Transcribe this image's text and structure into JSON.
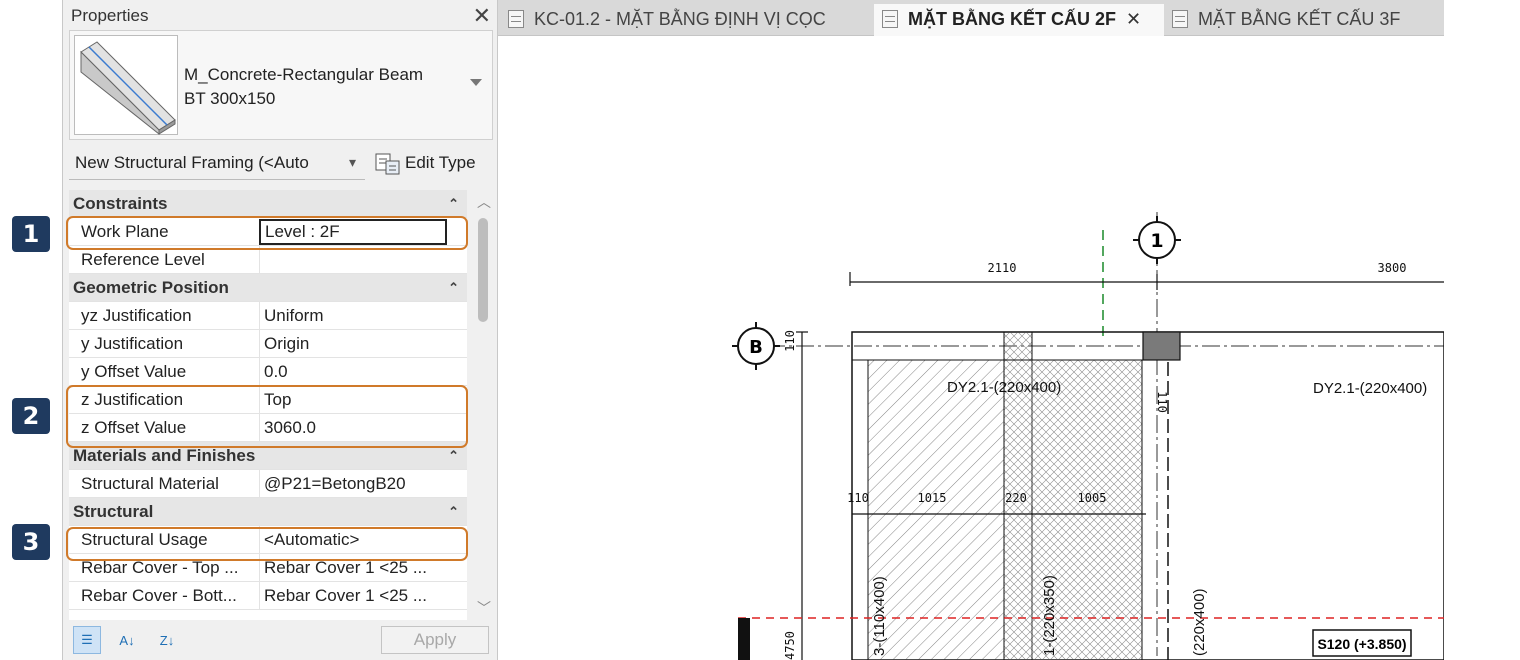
{
  "badges": [
    "1",
    "2",
    "3"
  ],
  "properties": {
    "title": "Properties",
    "family_line1": "M_Concrete-Rectangular Beam",
    "family_line2": "BT 300x150",
    "instance_selector": "New Structural Framing (<Auto",
    "edit_type_label": "Edit Type",
    "sections": {
      "constraints": "Constraints",
      "geometric_position": "Geometric Position",
      "materials": "Materials and Finishes",
      "structural": "Structural"
    },
    "rows": [
      {
        "name": "Work Plane",
        "value": "Level : 2F"
      },
      {
        "name": "Reference Level",
        "value": ""
      },
      {
        "name": "yz Justification",
        "value": "Uniform"
      },
      {
        "name": "y Justification",
        "value": "Origin"
      },
      {
        "name": "y Offset Value",
        "value": "0.0"
      },
      {
        "name": "z Justification",
        "value": "Top"
      },
      {
        "name": "z Offset Value",
        "value": "3060.0"
      },
      {
        "name": "Structural Material",
        "value": "@P21=BetongB20"
      },
      {
        "name": "Structural Usage",
        "value": "<Automatic>"
      },
      {
        "name": "Rebar Cover - Top ...",
        "value": "Rebar Cover 1 <25 ..."
      },
      {
        "name": "Rebar Cover - Bott...",
        "value": "Rebar Cover 1 <25 ..."
      }
    ],
    "apply_label": "Apply"
  },
  "tabs": [
    {
      "label": "KC-01.2 - MẶT BẰNG ĐỊNH VỊ CỌC"
    },
    {
      "label": "MẶT BẰNG KẾT CẤU 2F"
    },
    {
      "label": "MẶT BẰNG KẾT CẤU 3F"
    }
  ],
  "drawing": {
    "grid_1": "1",
    "grid_b": "B",
    "dim_top_left": "2110",
    "dim_top_right": "3800",
    "dim_110_left": "110",
    "dim_110_mid": "110",
    "dim_row": [
      "110",
      "1015",
      "220",
      "1005"
    ],
    "beam_left": "DY2.1-(220x400)",
    "beam_right": "DY2.1-(220x400)",
    "vert_1": "3-(110x400)",
    "vert_2": "1-(220x350)",
    "vert_3": "(220x400)",
    "dim_bottom": "4750",
    "level_tag": "S120 (+3.850)"
  }
}
